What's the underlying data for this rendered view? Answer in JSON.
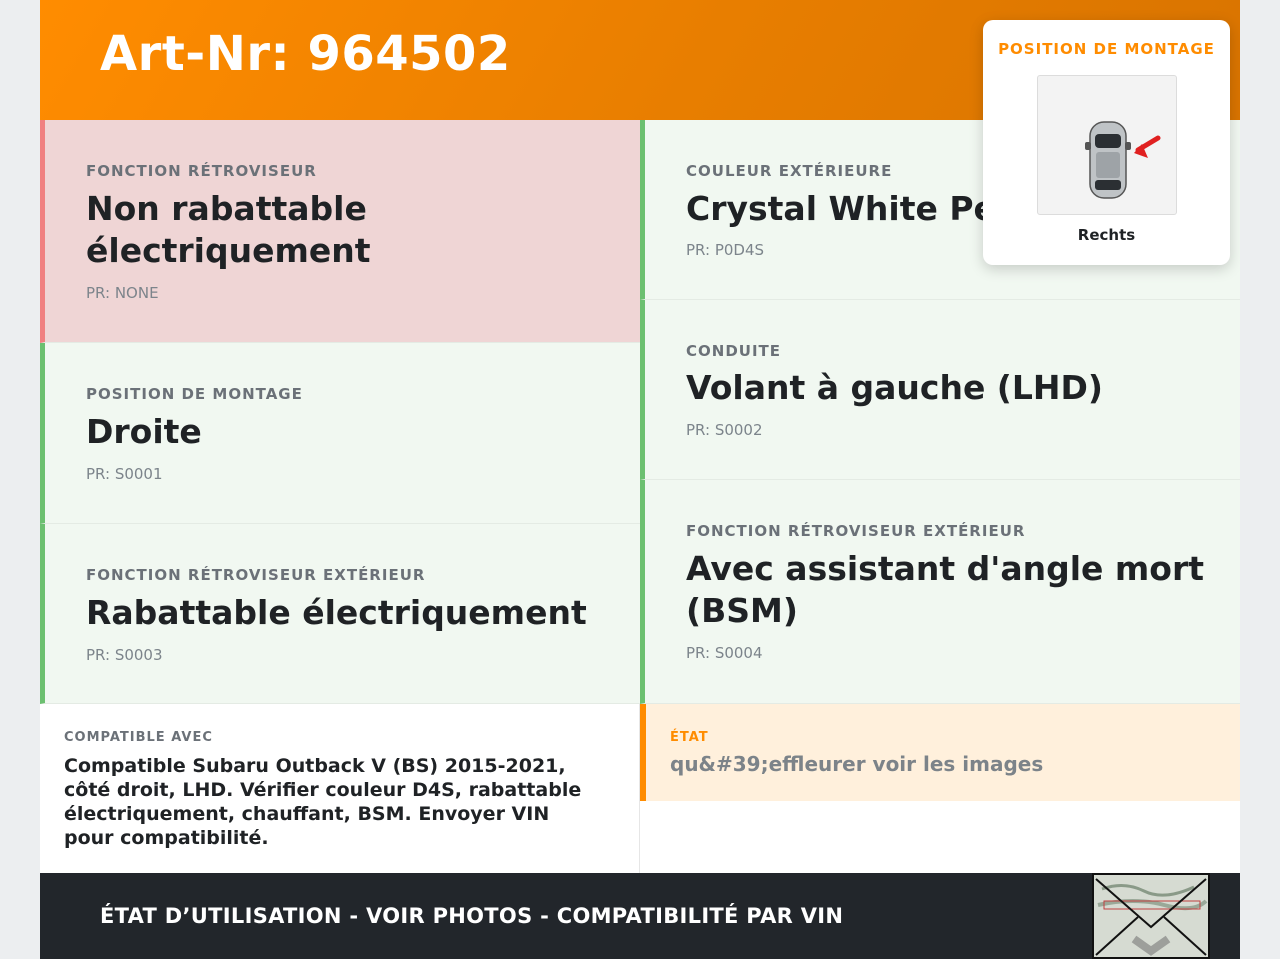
{
  "header": {
    "title": "Art-Nr: 964502"
  },
  "cards": {
    "left": [
      {
        "label": "FONCTION RÉTROVISEUR",
        "value_line1": "Non rabattable",
        "value_line2": "électriquement",
        "pr": "PR: NONE"
      },
      {
        "label": "POSITION DE MONTAGE",
        "value_line1": "Droite",
        "pr": "PR: S0001"
      },
      {
        "label": "FONCTION RÉTROVISEUR EXTÉRIEUR",
        "value_line1": "Rabattable électriquement",
        "pr": "PR: S0003"
      }
    ],
    "right": [
      {
        "label": "COULEUR EXTÉRIEURE",
        "value_line1": "Crystal White Pearl",
        "pr": "PR: P0D4S"
      },
      {
        "label": "CONDUITE",
        "value_line1": "Volant à gauche (LHD)",
        "pr": "PR: S0002"
      },
      {
        "label": "FONCTION RÉTROVISEUR EXTÉRIEUR",
        "value_line1": "Avec assistant d'angle mort",
        "value_line2": "(BSM)",
        "pr": "PR: S0004"
      }
    ]
  },
  "compat": {
    "label": "COMPATIBLE AVEC",
    "text": "Compatible Subaru Outback V (BS) 2015-2021, côté droit, LHD. Vérifier couleur D4S, rabattable électriquement, chauffant, BSM. Envoyer VIN pour compatibilité."
  },
  "etat": {
    "label": "ÉTAT",
    "text": "qu&#39;effleurer voir les images"
  },
  "footer": {
    "text": "ÉTAT D’UTILISATION - VOIR PHOTOS - COMPATIBILITÉ PAR VIN"
  },
  "popup": {
    "title": "POSITION DE MONTAGE",
    "caption": "Rechts",
    "image_icon": "car-top-view-icon"
  },
  "colors": {
    "accent": "#ff8c00",
    "ok_border": "#6cc070",
    "warn_border": "#f08080",
    "footer_bg": "#22262b"
  }
}
